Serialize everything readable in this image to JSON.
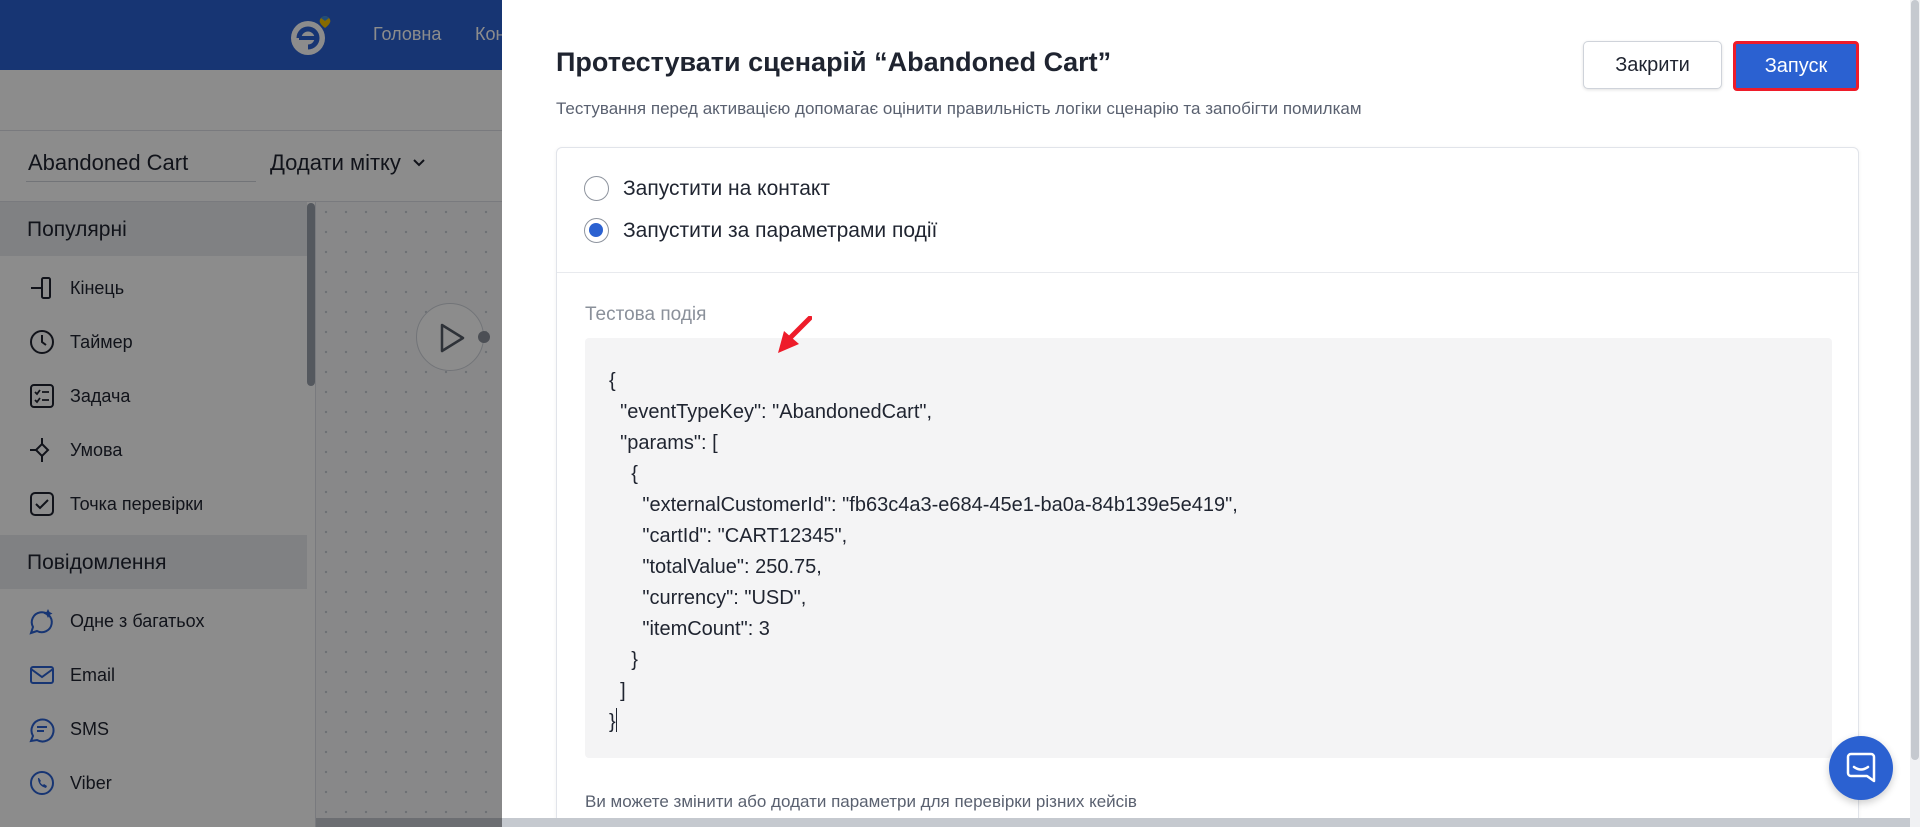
{
  "topbar": {
    "nav": [
      "Головна",
      "Кон"
    ]
  },
  "scenario": {
    "name": "Abandoned Cart",
    "add_tag_label": "Додати мітку"
  },
  "sidebar": {
    "sections": [
      {
        "title": "Популярні",
        "items": [
          "Кінець",
          "Таймер",
          "Задача",
          "Умова",
          "Точка перевірки"
        ]
      },
      {
        "title": "Повідомлення",
        "items": [
          "Одне з багатьох",
          "Email",
          "SMS",
          "Viber"
        ]
      }
    ]
  },
  "modal": {
    "title": "Протестувати сценарій “Abandoned Cart”",
    "subtitle": "Тестування перед активацією допомагає оцінити правильність логіки сценарію та запобігти помилкам",
    "close_label": "Закрити",
    "run_label": "Запуск",
    "options": [
      {
        "label": "Запустити на контакт",
        "checked": false
      },
      {
        "label": "Запустити за параметрами події",
        "checked": true
      }
    ],
    "event_label": "Тестова подія",
    "event_json": "{\n  \"eventTypeKey\": \"AbandonedCart\",\n  \"params\": [\n    {\n      \"externalCustomerId\": \"fb63c4a3-e684-45e1-ba0a-84b139e5e419\",\n      \"cartId\": \"CART12345\",\n      \"totalValue\": 250.75,\n      \"currency\": \"USD\",\n      \"itemCount\": 3\n    }\n  ]\n}",
    "hint": "Ви можете змінити або додати параметри для перевірки різних кейсів"
  },
  "colors": {
    "brand": "#2b61d1",
    "highlight": "#ee1c2a"
  }
}
